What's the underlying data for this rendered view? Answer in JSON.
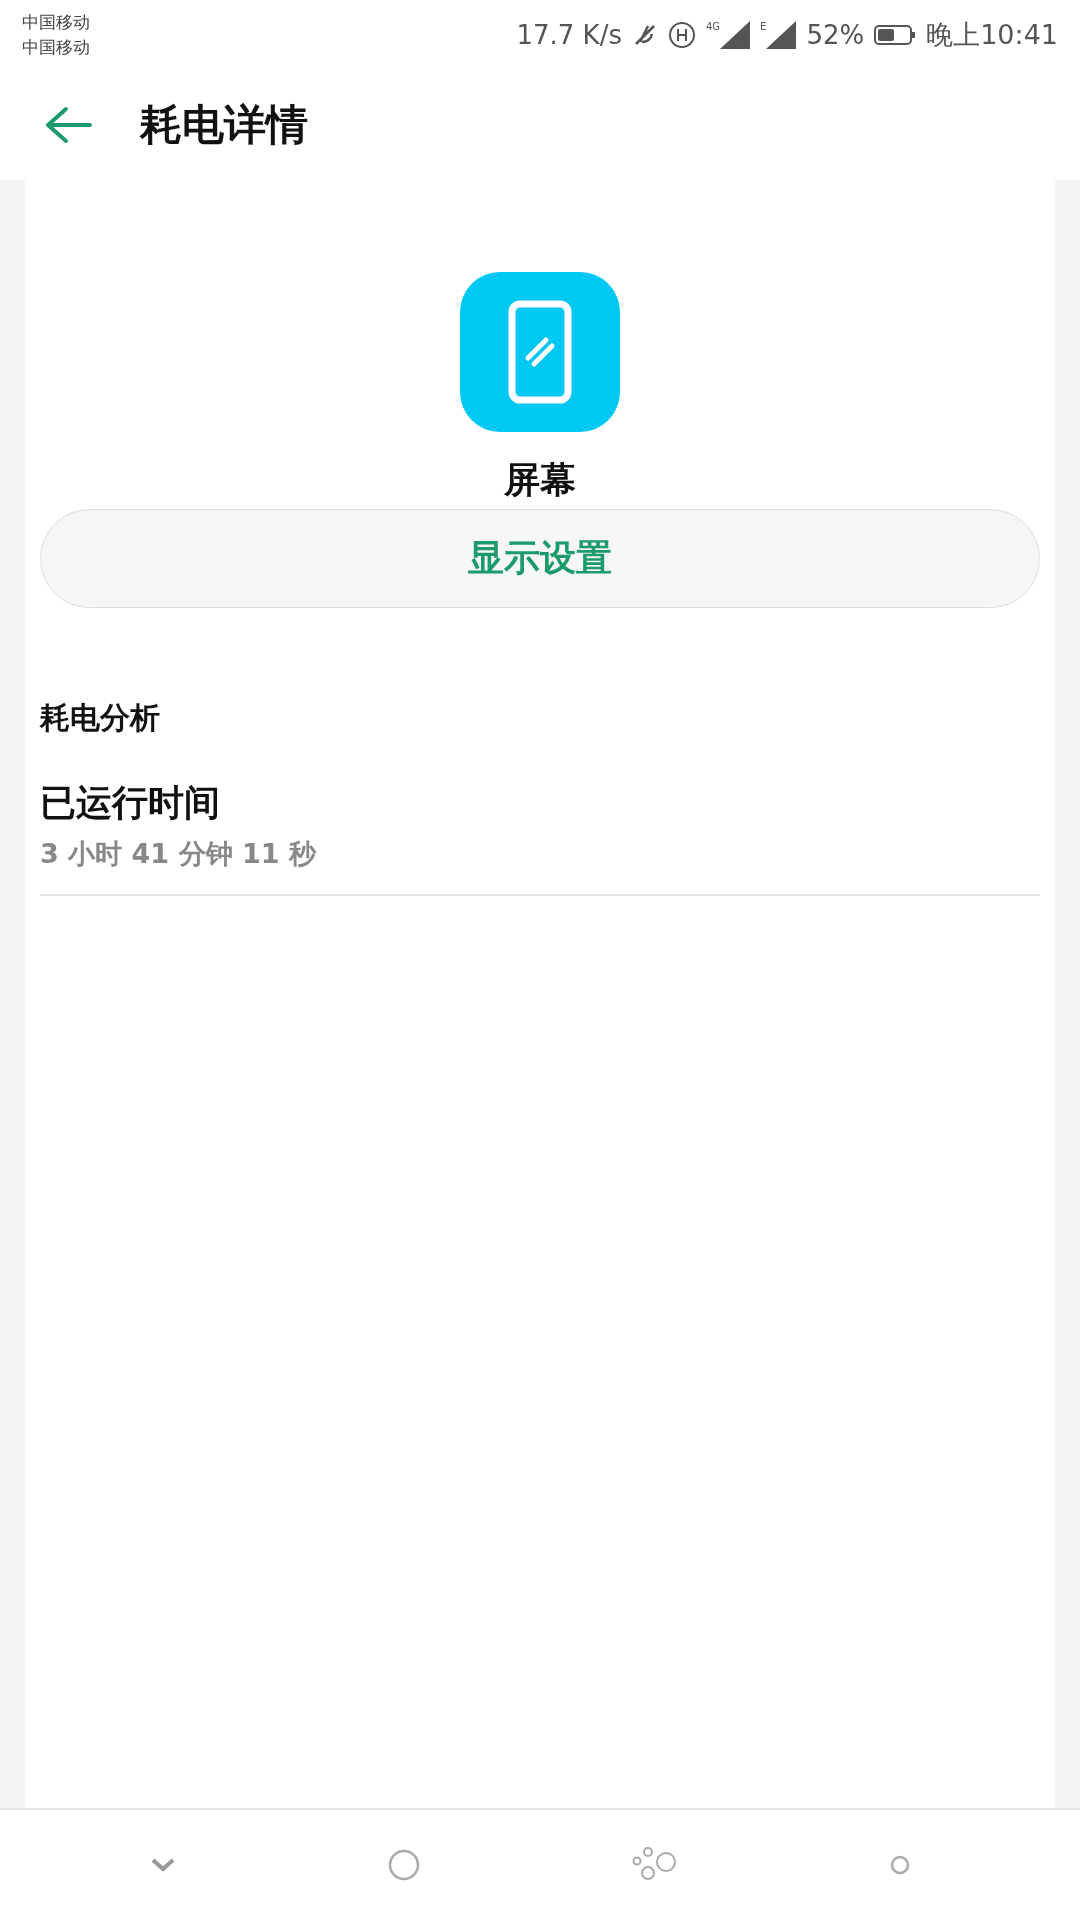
{
  "status_bar": {
    "carriers": [
      "中国移动",
      "中国移动"
    ],
    "speed": "17.7 K/s",
    "network_labels": [
      "4G",
      "E"
    ],
    "battery": "52%",
    "time": "晚上10:41"
  },
  "header": {
    "title": "耗电详情"
  },
  "item": {
    "name": "屏幕",
    "button": "显示设置"
  },
  "section": {
    "title": "耗电分析",
    "rows": [
      {
        "label": "已运行时间",
        "value": "3 小时 41 分钟 11 秒"
      }
    ]
  }
}
